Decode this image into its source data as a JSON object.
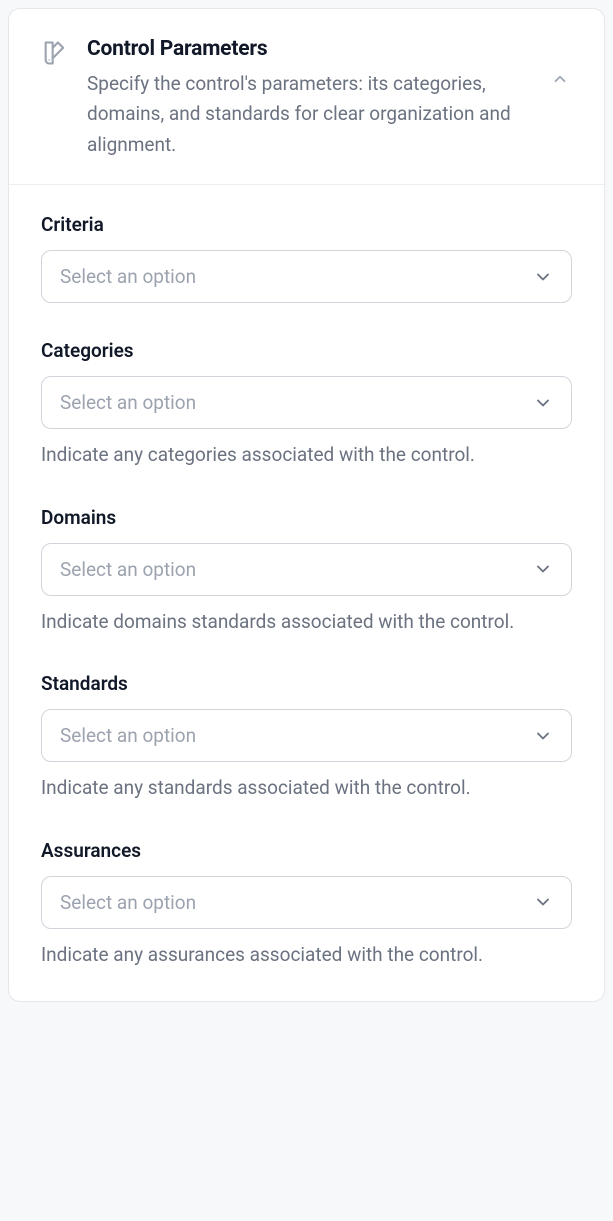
{
  "header": {
    "title": "Control Parameters",
    "description": "Specify the control's parameters: its categories, domains, and standards for clear organization and alignment."
  },
  "fields": {
    "criteria": {
      "label": "Criteria",
      "placeholder": "Select an option"
    },
    "categories": {
      "label": "Categories",
      "placeholder": "Select an option",
      "hint": "Indicate any categories associated with the control."
    },
    "domains": {
      "label": "Domains",
      "placeholder": "Select an option",
      "hint": "Indicate domains standards associated with the control."
    },
    "standards": {
      "label": "Standards",
      "placeholder": "Select an option",
      "hint": "Indicate any standards associated with the control."
    },
    "assurances": {
      "label": "Assurances",
      "placeholder": "Select an option",
      "hint": "Indicate any assurances associated with the control."
    }
  }
}
